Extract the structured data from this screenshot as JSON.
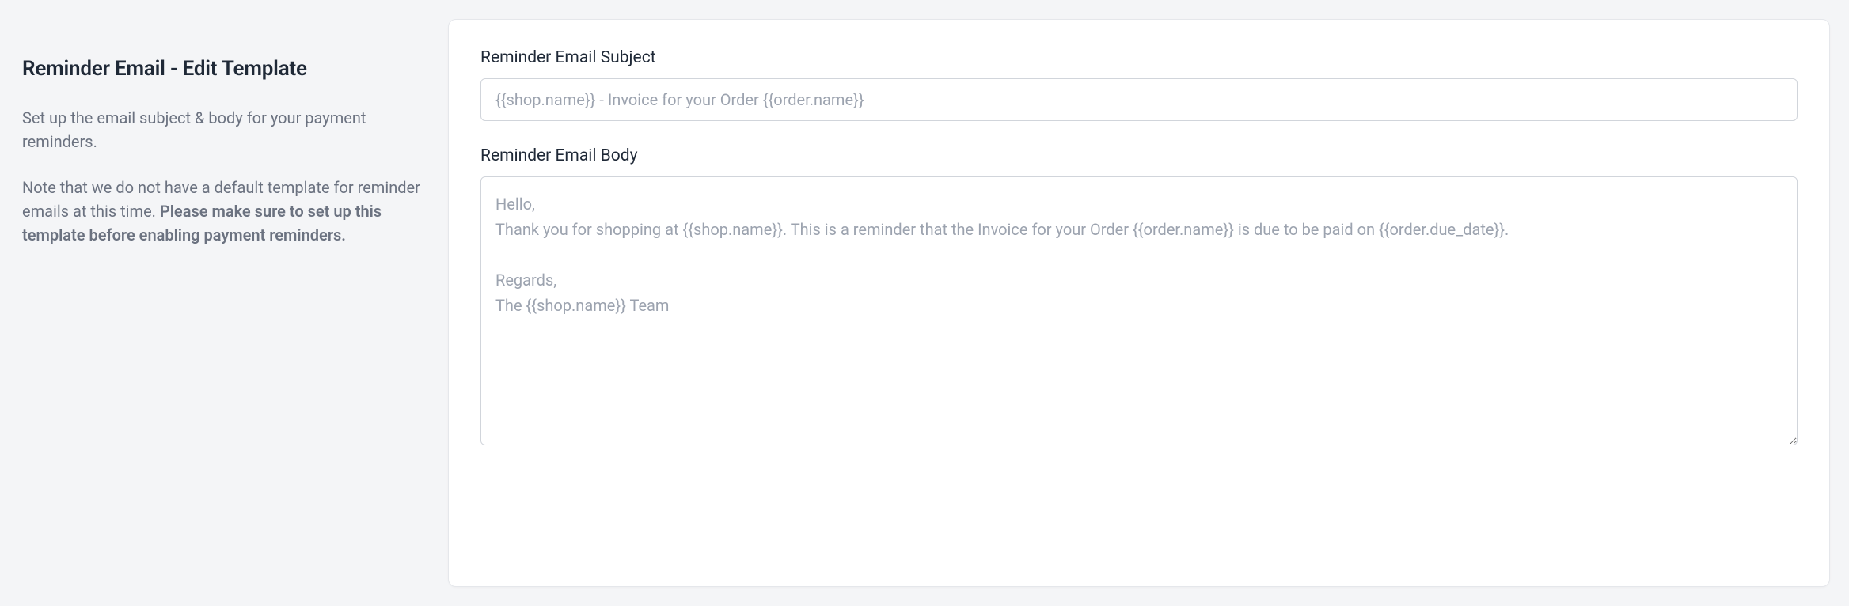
{
  "sidebar": {
    "title": "Reminder Email - Edit Template",
    "description": "Set up the email subject & body for your payment reminders.",
    "note_prefix": "Note that we do not have a default template for reminder emails at this time. ",
    "note_bold": "Please make sure to set up this template before enabling payment reminders."
  },
  "form": {
    "subject": {
      "label": "Reminder Email Subject",
      "placeholder": "{{shop.name}} - Invoice for your Order {{order.name}}",
      "value": ""
    },
    "body": {
      "label": "Reminder Email Body",
      "placeholder": "Hello,\nThank you for shopping at {{shop.name}}. This is a reminder that the Invoice for your Order {{order.name}} is due to be paid on {{order.due_date}}.\n\nRegards,\nThe {{shop.name}} Team",
      "value": ""
    }
  }
}
